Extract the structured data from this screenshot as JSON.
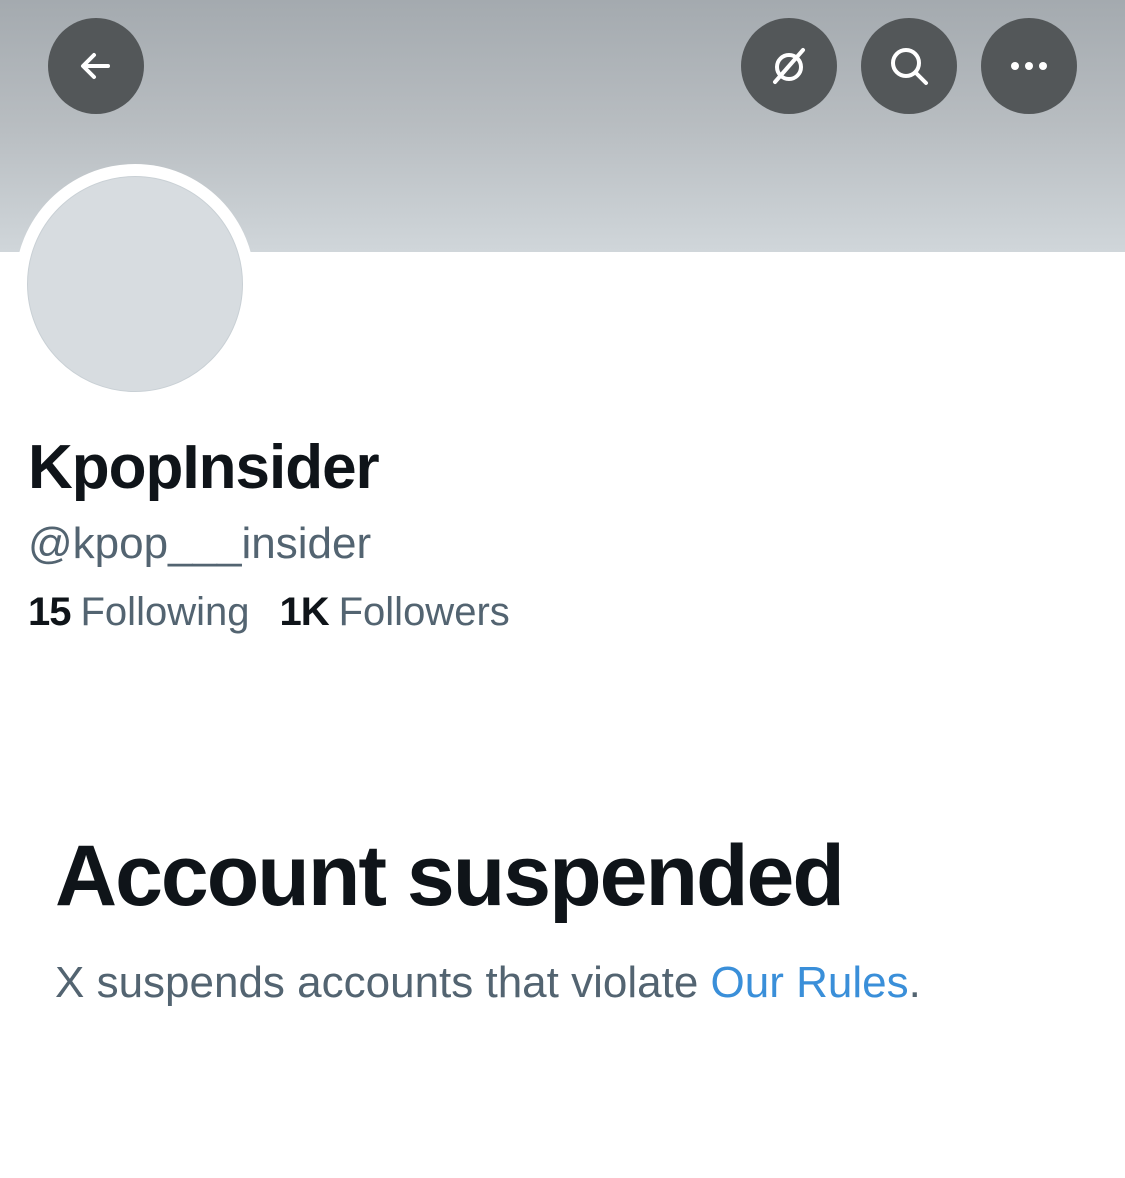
{
  "header": {
    "back_icon": "arrow-left-icon",
    "translate_icon": "translate-slash-icon",
    "search_icon": "search-icon",
    "more_icon": "more-horizontal-icon",
    "button_color": "#535759",
    "banner_color": "#b8bdc1"
  },
  "profile": {
    "avatar_color": "#d7dce0",
    "display_name": "KpopInsider",
    "handle": "@kpop___insider",
    "following_count": "15",
    "following_label": "Following",
    "followers_count": "1K",
    "followers_label": "Followers"
  },
  "suspension": {
    "title": "Account suspended",
    "description_prefix": "X suspends accounts that violate ",
    "rules_link": "Our Rules",
    "description_suffix": ".",
    "link_color": "#3a8fd9"
  }
}
